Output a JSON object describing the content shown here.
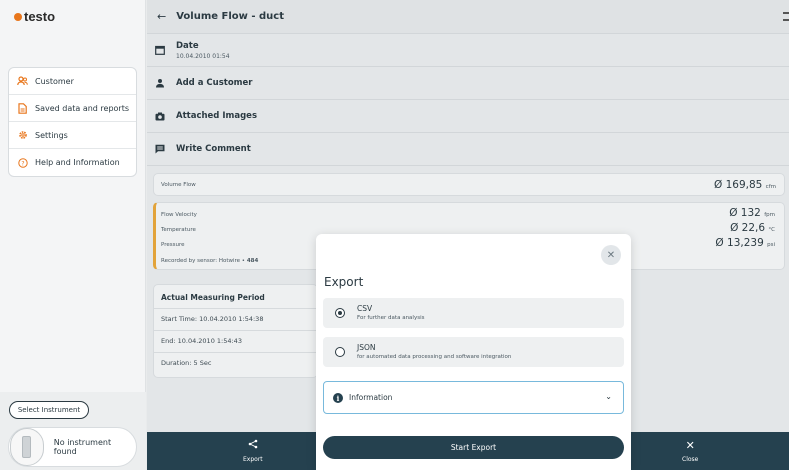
{
  "brand": {
    "logo_text": "testo",
    "accent": "#e8761c"
  },
  "sidebar": {
    "items": [
      {
        "label": "Customer",
        "icon": "users-icon"
      },
      {
        "label": "Saved data and reports",
        "icon": "document-icon"
      },
      {
        "label": "Settings",
        "icon": "gear-icon"
      },
      {
        "label": "Help and Information",
        "icon": "question-icon"
      }
    ],
    "select_instrument_label": "Select Instrument",
    "instrument_status": "No instrument found"
  },
  "header": {
    "title": "Volume Flow - duct"
  },
  "details": {
    "date_label": "Date",
    "date_value": "10.04.2010 01:54",
    "add_customer": "Add a Customer",
    "attached_images": "Attached Images",
    "write_comment": "Write Comment"
  },
  "volume_flow": {
    "label": "Volume Flow",
    "value": "Ø 169,85",
    "unit": "cfm"
  },
  "measurements": {
    "rows": [
      {
        "label": "Flow Velocity",
        "value": "Ø 132",
        "unit": "fpm"
      },
      {
        "label": "Temperature",
        "value": "Ø 22,6",
        "unit": "°C"
      },
      {
        "label": "Pressure",
        "value": "Ø 13,239",
        "unit": "psi"
      }
    ],
    "recorded_by": "Recorded by sensor:  Hotwire •",
    "sensor_id": "484"
  },
  "period": {
    "title": "Actual Measuring Period",
    "start": "Start Time: 10.04.2010 1:54:38",
    "end": "End: 10.04.2010 1:54:43",
    "duration": "Duration: 5 Sec"
  },
  "bottombar": {
    "export_label": "Export",
    "close_label": "Close"
  },
  "dialog": {
    "title": "Export",
    "options": [
      {
        "name": "CSV",
        "desc": "For further data analysis",
        "selected": true
      },
      {
        "name": "JSON",
        "desc": "for automated data processing and software integration",
        "selected": false
      }
    ],
    "info_label": "Information",
    "start_button": "Start Export"
  }
}
